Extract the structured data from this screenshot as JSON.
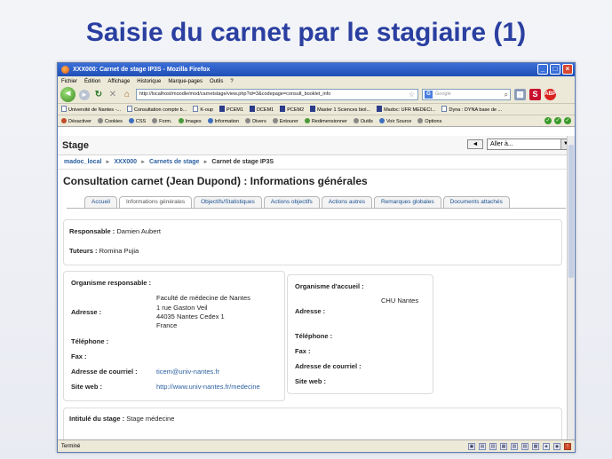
{
  "slide": {
    "title": "Saisie du carnet par le stagiaire (1)"
  },
  "browser": {
    "window_title": "XXX000: Carnet de stage IP3S - Mozilla Firefox",
    "menu": [
      "Fichier",
      "Édition",
      "Affichage",
      "Historique",
      "Marque-pages",
      "Outils",
      "?"
    ],
    "url": "http://localhost/moodle/mod/carnetstage/view.php?id=3&codepage=consult_booklet_info",
    "search_placeholder": "Google",
    "bookmarks": [
      "Université de Nantes -...",
      "Consultation compte b...",
      "K-oup",
      "PCEM1",
      "DCEM1",
      "PCEM2",
      "Master 1 Sciences biol...",
      "Madoc: UFR MEDECI...",
      "Dyna : DYNA base de ..."
    ],
    "devbar": [
      "Désactiver",
      "Cookies",
      "CSS",
      "Form.",
      "Images",
      "Information",
      "Divers",
      "Entourer",
      "Redimensionner",
      "Outils",
      "Voir Source",
      "Options"
    ],
    "status": "Terminé"
  },
  "page": {
    "header": "Stage",
    "goto_select": "Aller à...",
    "nav_arrow": "◄",
    "breadcrumb": [
      "madoc_local",
      "XXX000",
      "Carnets de stage",
      "Carnet de stage IP3S"
    ],
    "title": "Consultation carnet (Jean Dupond) : Informations générales",
    "tabs": [
      "Accueil",
      "Informations générales",
      "Objectifs/Statistiques",
      "Actions objectifs",
      "Actions autres",
      "Remarques globales",
      "Documents attachés"
    ],
    "active_tab": "Informations générales",
    "responsable_label": "Responsable :",
    "responsable_value": "Damien Aubert",
    "tuteurs_label": "Tuteurs :",
    "tuteurs_value": "Romina Pujia",
    "org_resp": {
      "heading": "Organisme responsable :",
      "name": "Faculté de médecine de Nantes",
      "adresse_label": "Adresse :",
      "address_lines": [
        "1 rue Gaston Veil",
        "44035 Nantes Cedex 1",
        "France"
      ],
      "telephone_label": "Téléphone :",
      "fax_label": "Fax :",
      "email_label": "Adresse de courriel :",
      "email": "ticem@univ-nantes.fr",
      "web_label": "Site web :",
      "web": "http://www.univ-nantes.fr/medecine"
    },
    "org_accueil": {
      "heading": "Organisme d'accueil :",
      "name": "CHU Nantes",
      "adresse_label": "Adresse :",
      "telephone_label": "Téléphone :",
      "fax_label": "Fax :",
      "email_label": "Adresse de courriel :",
      "web_label": "Site web :"
    },
    "intitule_label": "Intitulé du stage :",
    "intitule_value": "Stage médecine"
  }
}
